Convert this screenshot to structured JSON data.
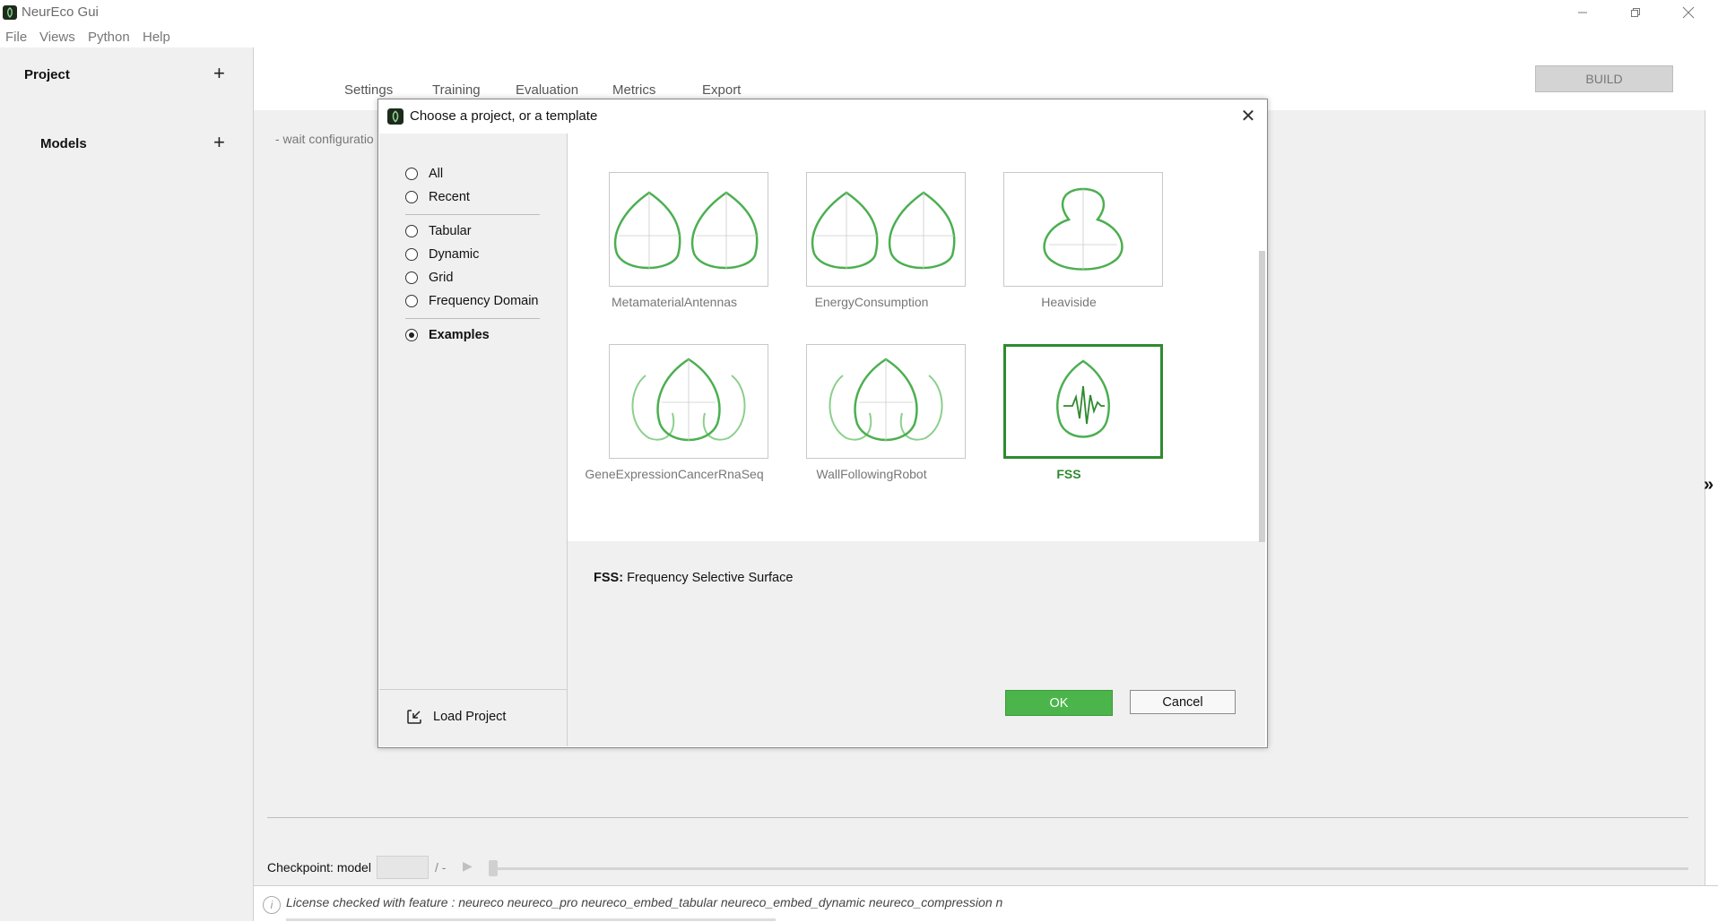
{
  "window": {
    "title": "NeurEco Gui",
    "controls": [
      "minimize-icon",
      "restore-icon",
      "close-icon"
    ]
  },
  "menu": [
    "File",
    "Views",
    "Python",
    "Help"
  ],
  "sidebar": {
    "project_label": "Project",
    "models_label": "Models",
    "add_symbol": "+"
  },
  "tabs": [
    "Settings",
    "Training",
    "Evaluation",
    "Metrics",
    "Export"
  ],
  "build_label": "BUILD",
  "main": {
    "wait_text": "- wait configuratio",
    "expand_symbol": "»"
  },
  "checkpoint": {
    "label": "Checkpoint: model",
    "value": "",
    "separator": "/ -",
    "play_symbol": "▶",
    "slider_value": 0
  },
  "status": {
    "license_text": "License checked with feature : neureco neureco_pro neureco_embed_tabular neureco_embed_dynamic neureco_compression n"
  },
  "dialog": {
    "title": "Choose a project, or a template",
    "close_symbol": "✕",
    "filters": [
      {
        "label": "All",
        "selected": false
      },
      {
        "label": "Recent",
        "selected": false
      },
      {
        "label": "Tabular",
        "selected": false
      },
      {
        "label": "Dynamic",
        "selected": false
      },
      {
        "label": "Grid",
        "selected": false
      },
      {
        "label": "Frequency Domain",
        "selected": false
      },
      {
        "label": "Examples",
        "selected": true
      }
    ],
    "load_project_label": "Load Project",
    "templates": [
      {
        "label": "MetamaterialAntennas",
        "icon": "twin-leaves-icon",
        "selected": false
      },
      {
        "label": "EnergyConsumption",
        "icon": "twin-leaves-icon",
        "selected": false
      },
      {
        "label": "Heaviside",
        "icon": "heaviside-shape-icon",
        "selected": false
      },
      {
        "label": "GeneExpressionCancerRnaSeq",
        "icon": "triple-leaves-icon",
        "selected": false
      },
      {
        "label": "WallFollowingRobot",
        "icon": "triple-leaves-icon",
        "selected": false
      },
      {
        "label": "FSS",
        "icon": "leaf-waveform-icon",
        "selected": true
      }
    ],
    "description_key": "FSS:",
    "description_value": "Frequency Selective Surface",
    "ok_label": "OK",
    "cancel_label": "Cancel"
  },
  "colors": {
    "accent_green": "#4bb54b",
    "selected_green": "#2f8a2f",
    "icon_green": "#4caf50"
  }
}
